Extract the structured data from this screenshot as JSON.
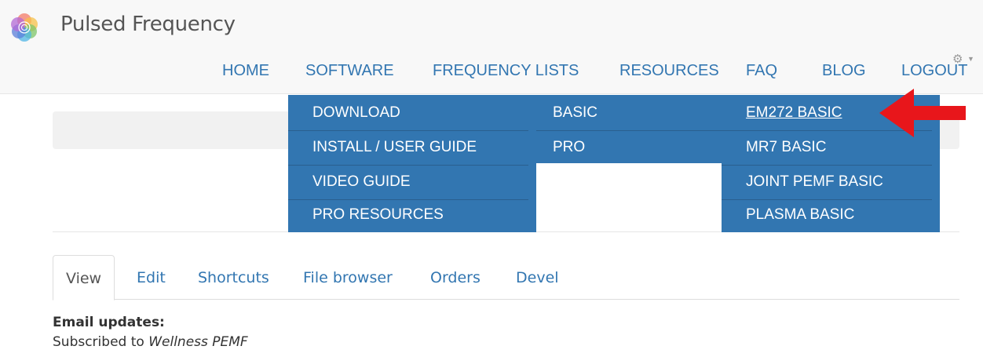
{
  "site": {
    "name": "Pulsed Frequency",
    "logo_icon": "flower-of-life-logo"
  },
  "nav": {
    "items": [
      {
        "label": "HOME"
      },
      {
        "label": "SOFTWARE"
      },
      {
        "label": "FREQUENCY LISTS"
      },
      {
        "label": "RESOURCES"
      },
      {
        "label": "FAQ"
      },
      {
        "label": "BLOG"
      },
      {
        "label": "LOGOUT"
      }
    ],
    "settings_icon": "gear-icon"
  },
  "software_menu": {
    "level1": [
      {
        "label": "DOWNLOAD"
      },
      {
        "label": "INSTALL / USER GUIDE"
      },
      {
        "label": "VIDEO GUIDE"
      },
      {
        "label": "PRO RESOURCES"
      }
    ],
    "level2": [
      {
        "label": "BASIC"
      },
      {
        "label": "PRO"
      }
    ],
    "level3": [
      {
        "label": "EM272 BASIC",
        "highlighted": true
      },
      {
        "label": "MR7 BASIC"
      },
      {
        "label": "JOINT PEMF BASIC"
      },
      {
        "label": "PLASMA BASIC"
      }
    ]
  },
  "tabs": [
    {
      "label": "View",
      "active": true
    },
    {
      "label": "Edit"
    },
    {
      "label": "Shortcuts"
    },
    {
      "label": "File browser"
    },
    {
      "label": "Orders"
    },
    {
      "label": "Devel"
    }
  ],
  "profile": {
    "email_label": "Email updates:",
    "subscribed_prefix": "Subscribed to",
    "subscription": "Wellness PEMF"
  },
  "colors": {
    "accent": "#3276b1",
    "annotation_arrow": "#e8161b"
  }
}
